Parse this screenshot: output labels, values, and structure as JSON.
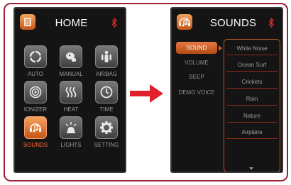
{
  "home_screen": {
    "title": "HOME",
    "header_icon": "menu-list-icon",
    "status_icon": "bluetooth-icon",
    "tiles": [
      {
        "label": "AUTO",
        "icon": "auto-cycle-icon",
        "active": false
      },
      {
        "label": "MANUAL",
        "icon": "massage-hand-icon",
        "active": false
      },
      {
        "label": "AIRBAG",
        "icon": "airbag-body-icon",
        "active": false
      },
      {
        "label": "IONIZER",
        "icon": "ionizer-icon",
        "active": false
      },
      {
        "label": "HEAT",
        "icon": "heat-waves-icon",
        "active": false
      },
      {
        "label": "TIME",
        "icon": "clock-icon",
        "active": false
      },
      {
        "label": "SOUNDS",
        "icon": "music-note-icon",
        "active": true
      },
      {
        "label": "LIGHTS",
        "icon": "light-bulb-icon",
        "active": false
      },
      {
        "label": "SETTING",
        "icon": "gear-icon",
        "active": false
      }
    ]
  },
  "transition_arrow": "right-arrow-icon",
  "sounds_screen": {
    "title": "SOUNDS",
    "header_icon": "music-note-icon",
    "status_icon": "bluetooth-icon",
    "menu": [
      {
        "label": "SOUND",
        "active": true
      },
      {
        "label": "VOLUME",
        "active": false
      },
      {
        "label": "BEEP",
        "active": false
      },
      {
        "label": "DEMO VOICE",
        "active": false
      }
    ],
    "sounds": [
      "White Noise",
      "Ocean Surf",
      "Crickets",
      "Rain",
      "Nature",
      "Airplane"
    ],
    "scroll_icon": "triangle-down-icon"
  },
  "colors": {
    "frame_border": "#a0203a",
    "accent_orange": "#e87944",
    "active_label": "#ff6d3a",
    "arrow_red": "#e0202a",
    "screen_bg": "#141414"
  }
}
